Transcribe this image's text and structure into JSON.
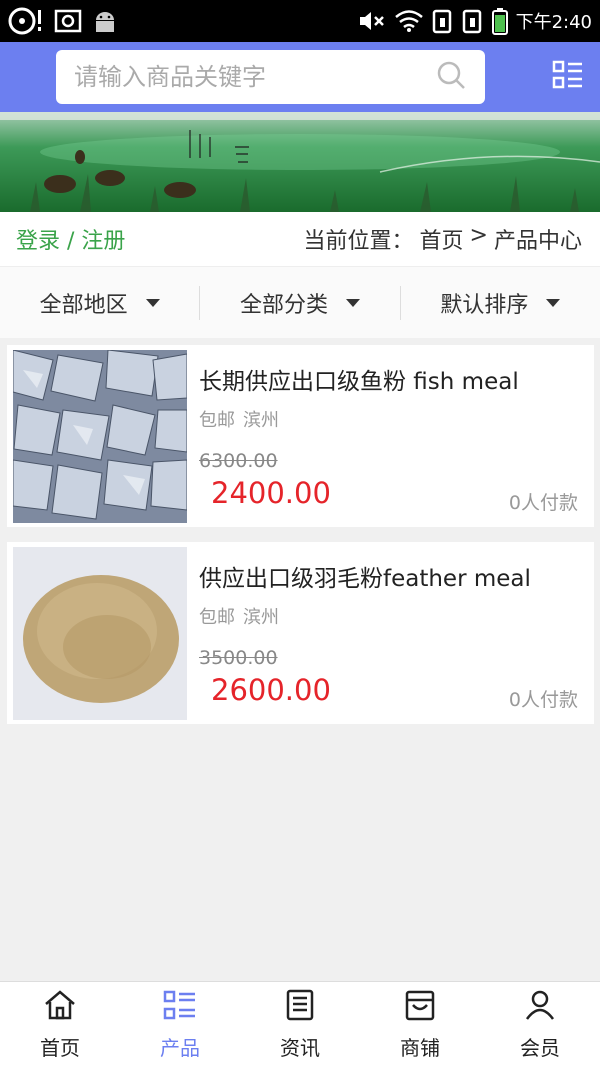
{
  "status_bar": {
    "time": "下午2:40"
  },
  "search": {
    "placeholder": "请输入商品关键字"
  },
  "location_bar": {
    "login_label": "登录 / 注册",
    "breadcrumb_prefix": "当前位置：",
    "breadcrumb_home": "首页",
    "breadcrumb_sep": ">",
    "breadcrumb_current": "产品中心"
  },
  "filters": [
    {
      "label": "全部地区"
    },
    {
      "label": "全部分类"
    },
    {
      "label": "默认排序"
    }
  ],
  "products": [
    {
      "title": "长期供应出口级鱼粉 fish meal",
      "shipping": "包邮",
      "city": "滨州",
      "old_price": "6300.00",
      "price": "2400.00",
      "sales": "0人付款"
    },
    {
      "title": "供应出口级羽毛粉feather meal",
      "shipping": "包邮",
      "city": "滨州",
      "old_price": "3500.00",
      "price": "2600.00",
      "sales": "0人付款"
    }
  ],
  "tabs": [
    {
      "label": "首页",
      "icon": "home-icon"
    },
    {
      "label": "产品",
      "icon": "grid-list-icon"
    },
    {
      "label": "资讯",
      "icon": "news-icon"
    },
    {
      "label": "商铺",
      "icon": "shop-icon"
    },
    {
      "label": "会员",
      "icon": "user-icon"
    }
  ],
  "colors": {
    "header": "#6c7ff0",
    "active_tab": "#6c7ff0",
    "price": "#e5242a",
    "login_link": "#3aa34a"
  }
}
